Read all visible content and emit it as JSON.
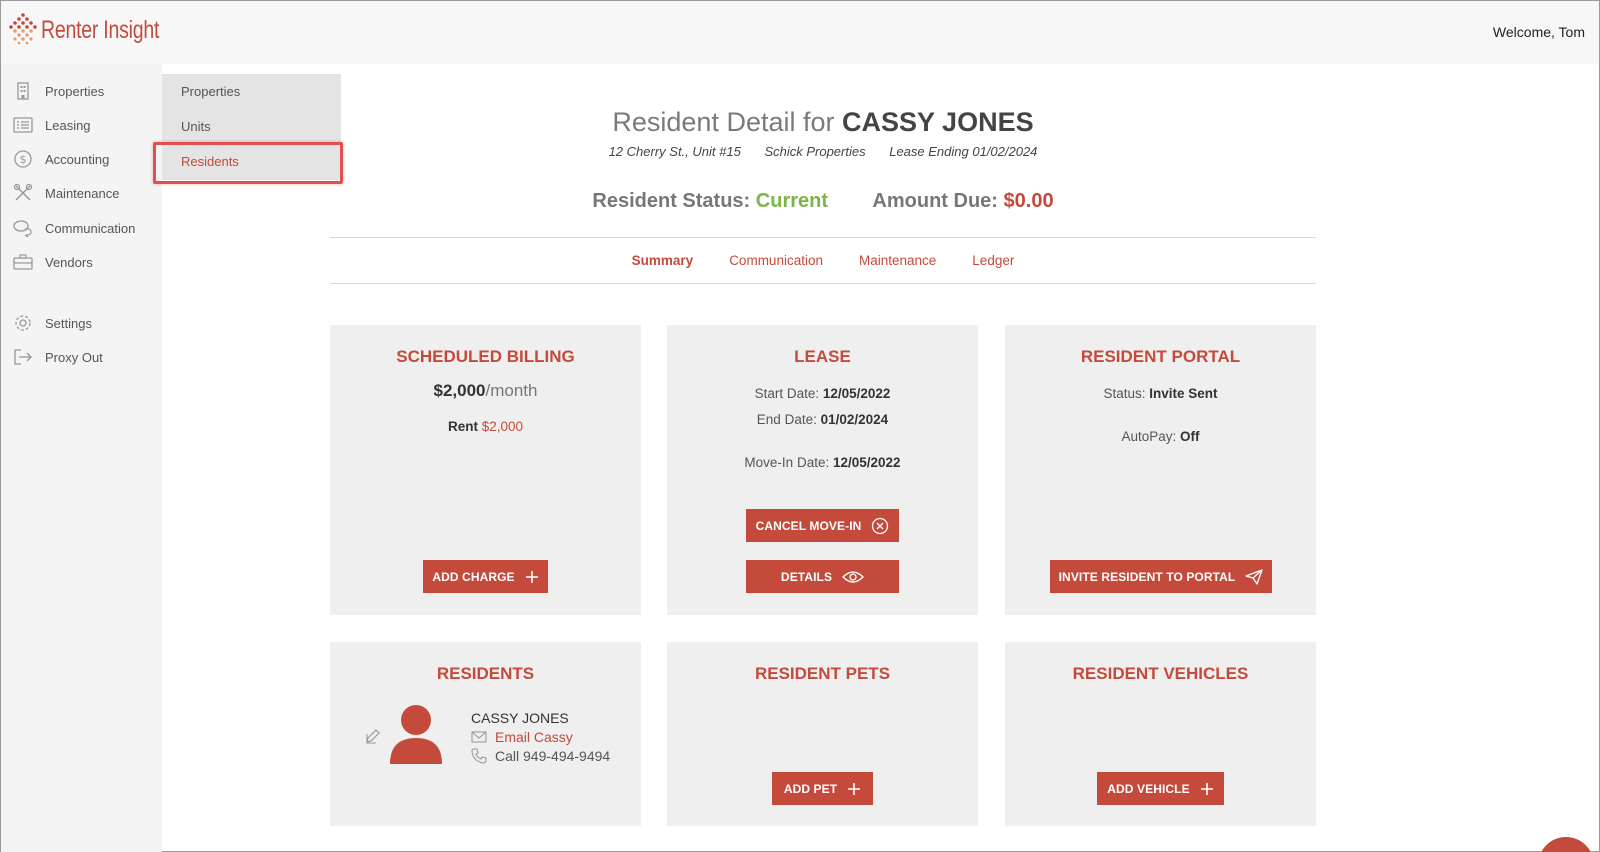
{
  "app": {
    "brand": "Renter Insight",
    "welcome": "Welcome, Tom",
    "accent": "#c44a3c"
  },
  "sidebar": {
    "items": [
      {
        "label": "Properties",
        "icon": "building-icon"
      },
      {
        "label": "Leasing",
        "icon": "list-icon"
      },
      {
        "label": "Accounting",
        "icon": "dollar-icon"
      },
      {
        "label": "Maintenance",
        "icon": "tools-icon"
      },
      {
        "label": "Communication",
        "icon": "chat-icon"
      },
      {
        "label": "Vendors",
        "icon": "briefcase-icon"
      },
      {
        "label": "Settings",
        "icon": "gear-icon"
      },
      {
        "label": "Proxy Out",
        "icon": "logout-icon"
      }
    ]
  },
  "submenu": {
    "items": [
      "Properties",
      "Units",
      "Residents"
    ],
    "active": "Residents"
  },
  "header": {
    "title_prefix": "Resident Detail for",
    "title_name": "CASSY JONES",
    "address": "12 Cherry St., Unit #15",
    "company": "Schick Properties",
    "lease_ending": "Lease Ending 01/02/2024",
    "status_label": "Resident Status:",
    "status_value": "Current",
    "due_label": "Amount Due:",
    "due_value": "$0.00"
  },
  "tabs": [
    "Summary",
    "Communication",
    "Maintenance",
    "Ledger"
  ],
  "cards": {
    "billing": {
      "title": "SCHEDULED BILLING",
      "amount": "$2,000",
      "period": "/month",
      "rent_label": "Rent",
      "rent_value": "$2,000",
      "button": "ADD CHARGE"
    },
    "lease": {
      "title": "LEASE",
      "start_label": "Start Date:",
      "start_value": "12/05/2022",
      "end_label": "End Date:",
      "end_value": "01/02/2024",
      "movein_label": "Move-In Date:",
      "movein_value": "12/05/2022",
      "cancel_button": "CANCEL MOVE-IN",
      "details_button": "DETAILS"
    },
    "portal": {
      "title": "RESIDENT PORTAL",
      "status_label": "Status:",
      "status_value": "Invite Sent",
      "autopay_label": "AutoPay:",
      "autopay_value": "Off",
      "button": "INVITE RESIDENT TO PORTAL"
    },
    "residents": {
      "title": "RESIDENTS",
      "name": "CASSY JONES",
      "email": "Email Cassy",
      "phone": "Call 949-494-9494"
    },
    "pets": {
      "title": "RESIDENT PETS",
      "button": "ADD PET"
    },
    "vehicles": {
      "title": "RESIDENT VEHICLES",
      "button": "ADD VEHICLE"
    }
  }
}
